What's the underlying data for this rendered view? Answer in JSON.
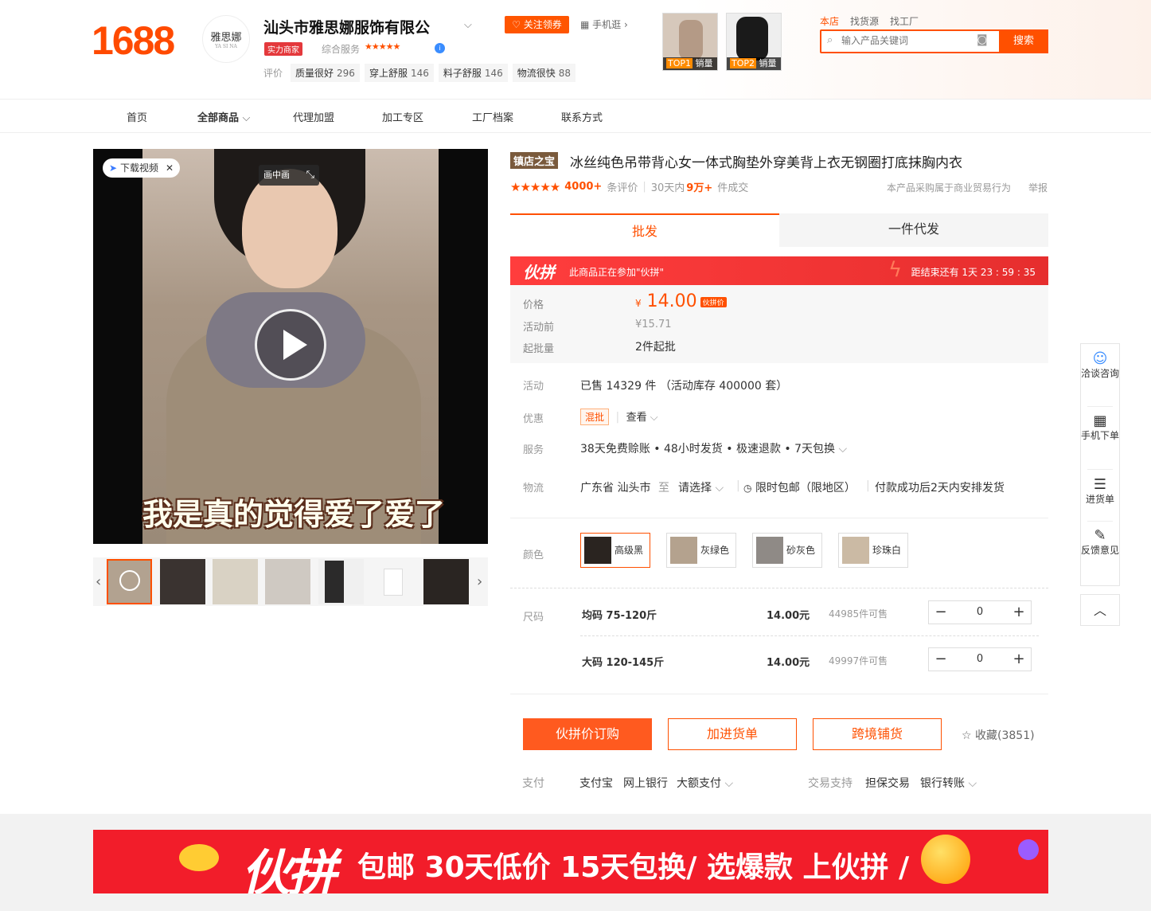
{
  "header": {
    "logo": "1688",
    "shop_logo_text": "雅思娜",
    "shop_logo_sub": "YA SI NA",
    "shop_name": "汕头市雅思娜服饰有限公",
    "badge": "实力商家",
    "service_label": "综合服务",
    "follow_label": "关注领券",
    "mobile_label": "手机逛",
    "review_label": "评价",
    "review_tags": [
      {
        "name": "质量很好",
        "count": "296"
      },
      {
        "name": "穿上舒服",
        "count": "146"
      },
      {
        "name": "料子舒服",
        "count": "146"
      },
      {
        "name": "物流很快",
        "count": "88"
      }
    ],
    "top_items": [
      {
        "rank": "TOP1",
        "label": "销量"
      },
      {
        "rank": "TOP2",
        "label": "销量"
      }
    ],
    "search_tabs": [
      "本店",
      "找货源",
      "找工厂"
    ],
    "search_placeholder": "输入产品关键词",
    "search_button": "搜索"
  },
  "menu": [
    "首页",
    "全部商品",
    "代理加盟",
    "加工专区",
    "工厂档案",
    "联系方式"
  ],
  "media": {
    "download_video": "下载视频",
    "pip": "画中画",
    "subtitle": "我是真的觉得爱了爱了"
  },
  "product": {
    "tag": "镇店之宝",
    "title": "冰丝纯色吊带背心女一体式胸垫外穿美背上衣无钢圈打底抹胸内衣",
    "review_count": "4000+",
    "review_suffix": "条评价",
    "sales_prefix": "30天内",
    "sales_count": "9万+",
    "sales_suffix": "件成交",
    "legal_note": "本产品采购属于商业贸易行为",
    "report": "举报",
    "tab_wholesale": "批发",
    "tab_dropship": "一件代发",
    "promo_logo": "伙拼",
    "promo_text": "此商品正在参加\"伙拼\"",
    "countdown": "距结束还有 1天 23 : 59 : 35",
    "price_label": "价格",
    "currency": "¥",
    "price": "14.00",
    "price_tag": "伙拼价",
    "before_label": "活动前",
    "before_price": "¥15.71",
    "min_label": "起批量",
    "min_value": "2件起批",
    "activity_label": "活动",
    "activity_value": "已售 14329 件 （活动库存 400000 套）",
    "discount_label": "优惠",
    "discount_tag": "混批",
    "discount_view": "查看",
    "service_label": "服务",
    "service_value": "38天免费赊账 • 48小时发货 • 极速退款 • 7天包换",
    "logistics_label": "物流",
    "logistics_from": "广东省 汕头市",
    "logistics_to": "至",
    "logistics_select": "请选择",
    "logistics_free": "限时包邮（限地区）",
    "logistics_ship": "付款成功后2天内安排发货",
    "color_label": "颜色",
    "colors": [
      "高级黑",
      "灰绿色",
      "砂灰色",
      "珍珠白"
    ],
    "size_label": "尺码",
    "sizes": [
      {
        "name": "均码 75-120斤",
        "price": "14.00元",
        "stock": "44985件可售",
        "qty": "0"
      },
      {
        "name": "大码 120-145斤",
        "price": "14.00元",
        "stock": "49997件可售",
        "qty": "0"
      }
    ],
    "btn_order": "伙拼价订购",
    "btn_cart": "加进货单",
    "btn_cross": "跨境铺货",
    "fav": "收藏(3851)",
    "pay_label": "支付",
    "pay_methods": [
      "支付宝",
      "网上银行",
      "大额支付"
    ],
    "trade_label": "交易支持",
    "trade_methods": [
      "担保交易",
      "银行转账"
    ]
  },
  "sidebar": {
    "chat": "洽谈咨询",
    "mobile": "手机下单",
    "cart": "进货单",
    "feedback": "反馈意见"
  },
  "banner": {
    "logo": "伙拼",
    "text": "包邮 30天低价 15天包换/ 选爆款 上伙拼 /"
  },
  "colors": {
    "accent": "#ff5000",
    "promo": "#f21d2a"
  }
}
